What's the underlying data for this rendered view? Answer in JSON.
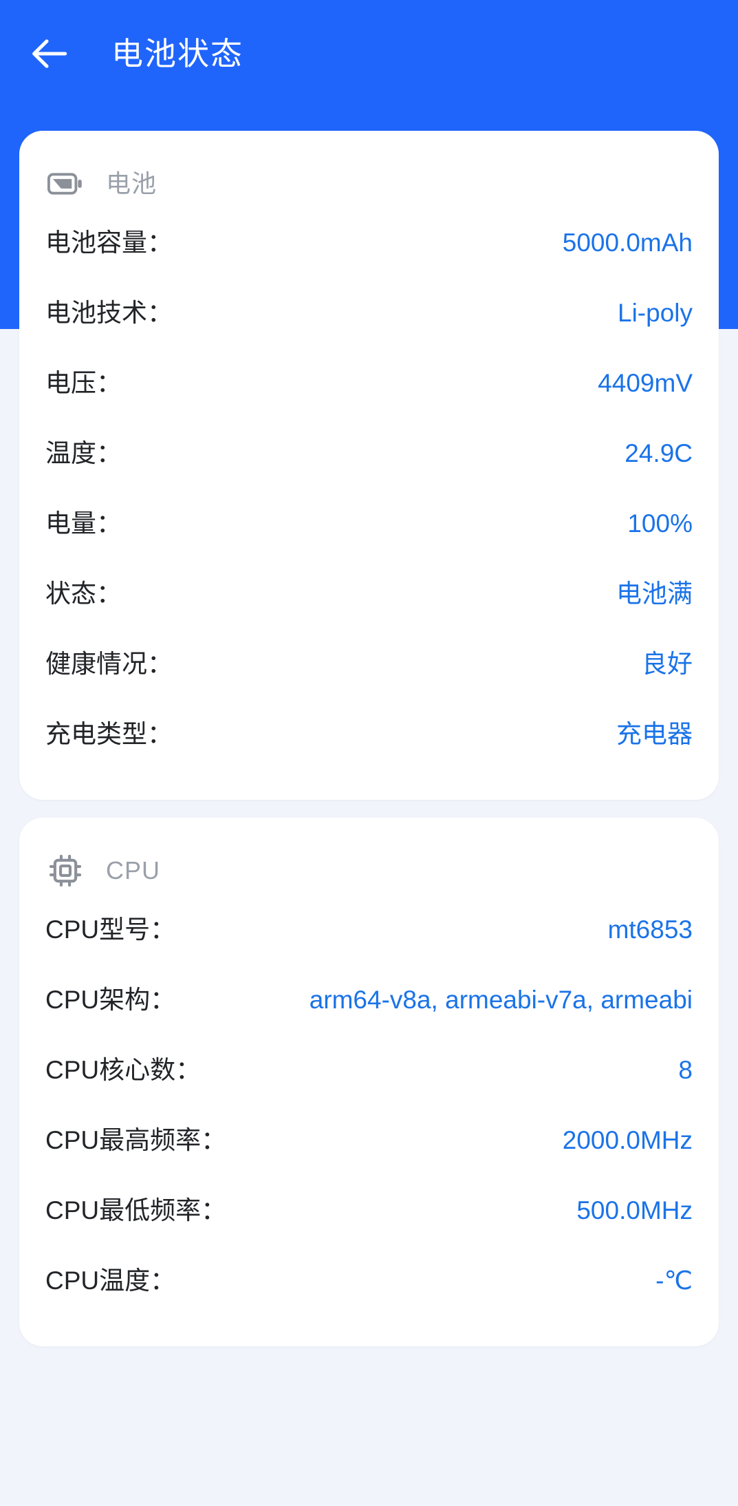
{
  "header": {
    "title": "电池状态",
    "back_icon": "arrow-left-icon",
    "background_color": "#2065fb",
    "title_color": "#ffffff"
  },
  "theme": {
    "page_background": "#f1f4fa",
    "card_background": "#ffffff",
    "label_color": "#222428",
    "value_color": "#1a73e8",
    "section_label_color": "#9aa0a9"
  },
  "cards": [
    {
      "id": "battery",
      "icon": "battery-icon",
      "title": "电池",
      "rows": [
        {
          "label": "电池容量：",
          "value": "5000.0mAh"
        },
        {
          "label": "电池技术：",
          "value": "Li-poly"
        },
        {
          "label": "电压：",
          "value": "4409mV"
        },
        {
          "label": "温度：",
          "value": "24.9C"
        },
        {
          "label": "电量：",
          "value": "100%"
        },
        {
          "label": "状态：",
          "value": "电池满"
        },
        {
          "label": "健康情况：",
          "value": "良好"
        },
        {
          "label": "充电类型：",
          "value": "充电器"
        }
      ]
    },
    {
      "id": "cpu",
      "icon": "cpu-chip-icon",
      "title": "CPU",
      "rows": [
        {
          "label": "CPU型号：",
          "value": "mt6853"
        },
        {
          "label": "CPU架构：",
          "value": "arm64-v8a, armeabi-v7a, armeabi"
        },
        {
          "label": "CPU核心数：",
          "value": "8"
        },
        {
          "label": "CPU最高频率：",
          "value": "2000.0MHz"
        },
        {
          "label": "CPU最低频率：",
          "value": "500.0MHz"
        },
        {
          "label": "CPU温度：",
          "value": "-℃"
        }
      ]
    }
  ]
}
